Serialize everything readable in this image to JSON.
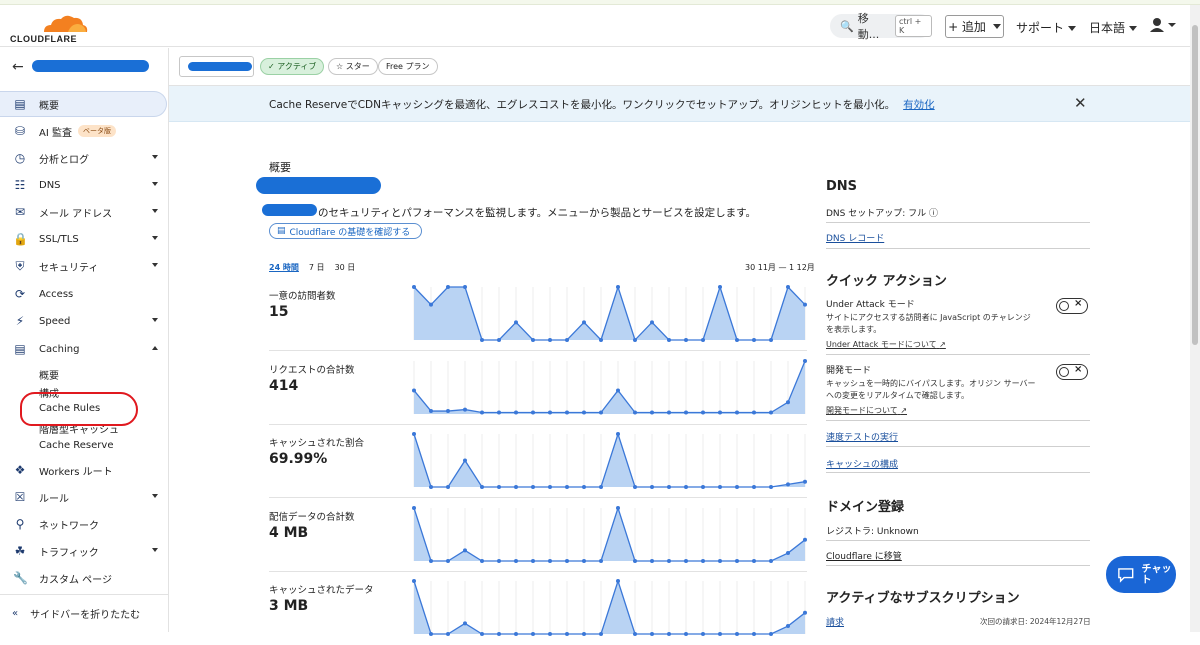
{
  "topbar": {
    "brand": "CLOUDFLARE",
    "search_label": "移動...",
    "search_shortcut": "ctrl + K",
    "add_label": "+ 追加",
    "support_label": "サポート",
    "language_label": "日本語"
  },
  "sidebar": {
    "items": [
      {
        "label": "概要",
        "icon": "document-icon"
      },
      {
        "label": "AI 監査",
        "icon": "ai-audit-icon",
        "badge": "ベータ版"
      },
      {
        "label": "分析とログ",
        "icon": "analytics-icon"
      },
      {
        "label": "DNS",
        "icon": "dns-icon"
      },
      {
        "label": "メール アドレス",
        "icon": "email-icon"
      },
      {
        "label": "SSL/TLS",
        "icon": "lock-icon"
      },
      {
        "label": "セキュリティ",
        "icon": "shield-icon"
      },
      {
        "label": "Access",
        "icon": "access-icon"
      },
      {
        "label": "Speed",
        "icon": "lightning-icon"
      },
      {
        "label": "Caching",
        "icon": "caching-icon"
      },
      {
        "label": "Workers ルート",
        "icon": "workers-icon"
      },
      {
        "label": "ルール",
        "icon": "rules-icon"
      },
      {
        "label": "ネットワーク",
        "icon": "location-icon"
      },
      {
        "label": "トラフィック",
        "icon": "traffic-icon"
      },
      {
        "label": "カスタム ページ",
        "icon": "wrench-icon"
      }
    ],
    "caching_sub": [
      "概要",
      "構成",
      "Cache Rules",
      "階層型キャッシュ",
      "Cache Reserve"
    ],
    "collapse_label": "サイドバーを折りたたむ"
  },
  "zone": {
    "status": "アクティブ",
    "star": "スター",
    "plan": "Free プラン"
  },
  "banner": {
    "text": "Cache ReserveでCDNキャッシングを最適化、エグレスコストを最小化。ワンクリックでセットアップ。オリジンヒットを最小化。",
    "link": "有効化"
  },
  "overview": {
    "heading": "概要",
    "description": "のセキュリティとパフォーマンスを監視します。メニューから製品とサービスを設定します。",
    "basics_link": "Cloudflare の基礎を確認する",
    "ranges": [
      "24 時間",
      "7 日",
      "30 日"
    ],
    "date_range": "30 11月 — 1 12月"
  },
  "metrics": [
    {
      "label": "一意の訪問者数",
      "value": "15"
    },
    {
      "label": "リクエストの合計数",
      "value": "414"
    },
    {
      "label": "キャッシュされた割合",
      "value": "69.99%"
    },
    {
      "label": "配信データの合計数",
      "value": "4 MB"
    },
    {
      "label": "キャッシュされたデータ",
      "value": "3 MB"
    }
  ],
  "chart_data": [
    {
      "type": "area",
      "name": "一意の訪問者数",
      "values": [
        3,
        2,
        3,
        3,
        0,
        0,
        1,
        0,
        0,
        0,
        1,
        0,
        3,
        0,
        1,
        0,
        0,
        0,
        3,
        0,
        0,
        0,
        3,
        2
      ]
    },
    {
      "type": "area",
      "name": "リクエストの合計数",
      "values": [
        8,
        1,
        1,
        1.5,
        0.5,
        0.5,
        0.5,
        0.5,
        0.5,
        0.5,
        0.5,
        0.5,
        8,
        0.5,
        0.5,
        0.5,
        0.5,
        0.5,
        0.5,
        0.5,
        0.5,
        0.5,
        4,
        18
      ]
    },
    {
      "type": "area",
      "name": "キャッシュされた割合",
      "values": [
        100,
        0,
        0,
        50,
        0,
        0,
        0,
        0,
        0,
        0,
        0,
        0,
        100,
        0,
        0,
        0,
        0,
        0,
        0,
        0,
        0,
        0,
        5,
        10
      ]
    },
    {
      "type": "area",
      "name": "配信データの合計数",
      "values": [
        100,
        0,
        0,
        20,
        0,
        0,
        0,
        0,
        0,
        0,
        0,
        0,
        100,
        0,
        0,
        0,
        0,
        0,
        0,
        0,
        0,
        0,
        15,
        40
      ]
    },
    {
      "type": "area",
      "name": "キャッシュされたデータ",
      "values": [
        100,
        0,
        0,
        20,
        0,
        0,
        0,
        0,
        0,
        0,
        0,
        0,
        100,
        0,
        0,
        0,
        0,
        0,
        0,
        0,
        0,
        0,
        15,
        40
      ]
    }
  ],
  "right": {
    "dns_title": "DNS",
    "dns_setup": "DNS セットアップ: フル",
    "dns_records": "DNS レコード",
    "quick_title": "クイック アクション",
    "under_attack": "Under Attack モード",
    "under_attack_desc": "サイトにアクセスする訪問者に JavaScript のチャレンジを表示します。",
    "under_attack_link": "Under Attack モードについて",
    "dev_mode": "開発モード",
    "dev_mode_desc": "キャッシュを一時的にバイパスします。オリジン サーバーへの変更をリアルタイムで確認します。",
    "dev_mode_link": "開発モードについて",
    "speed_test": "速度テストの実行",
    "cache_config": "キャッシュの構成",
    "domain_title": "ドメイン登録",
    "registrar": "レジストラ: Unknown",
    "move": "Cloudflare に移管",
    "subs_title": "アクティブなサブスクリプション",
    "billing": "請求",
    "next_bill": "次回の請求日: 2024年12月27日"
  },
  "chat_label": "チャット",
  "colors": {
    "accent": "#1a66d6",
    "area_fill": "#b9d3f3",
    "area_line": "#3b78d8"
  }
}
